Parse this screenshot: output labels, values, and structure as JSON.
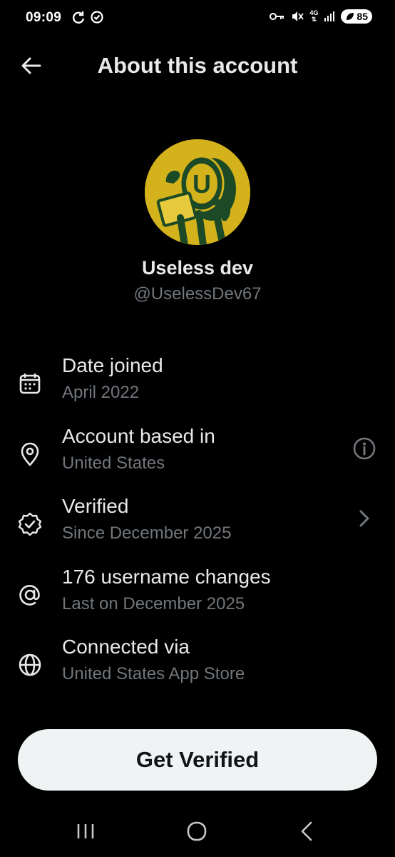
{
  "status_bar": {
    "time": "09:09",
    "network": "4G",
    "battery": "85"
  },
  "header": {
    "title": "About this account"
  },
  "profile": {
    "display_name": "Useless dev",
    "handle": "@UselessDev67",
    "avatar_letter": "U"
  },
  "details": [
    {
      "label": "Date joined",
      "value": "April 2022",
      "icon": "calendar-icon"
    },
    {
      "label": "Account based in",
      "value": "United States",
      "icon": "location-pin-icon",
      "trailing": "info-icon"
    },
    {
      "label": "Verified",
      "value": "Since December 2025",
      "icon": "verified-badge-icon",
      "trailing": "chevron-right-icon"
    },
    {
      "label": "176 username changes",
      "value": "Last on December 2025",
      "icon": "at-sign-icon"
    },
    {
      "label": "Connected via",
      "value": "United States App Store",
      "icon": "globe-icon"
    }
  ],
  "cta": {
    "label": "Get Verified"
  },
  "colors": {
    "background": "#000000",
    "primary_text": "#e7e9ea",
    "secondary_text": "#71767b",
    "button_bg": "#eff3f4",
    "avatar_bg": "#d4b21b"
  }
}
